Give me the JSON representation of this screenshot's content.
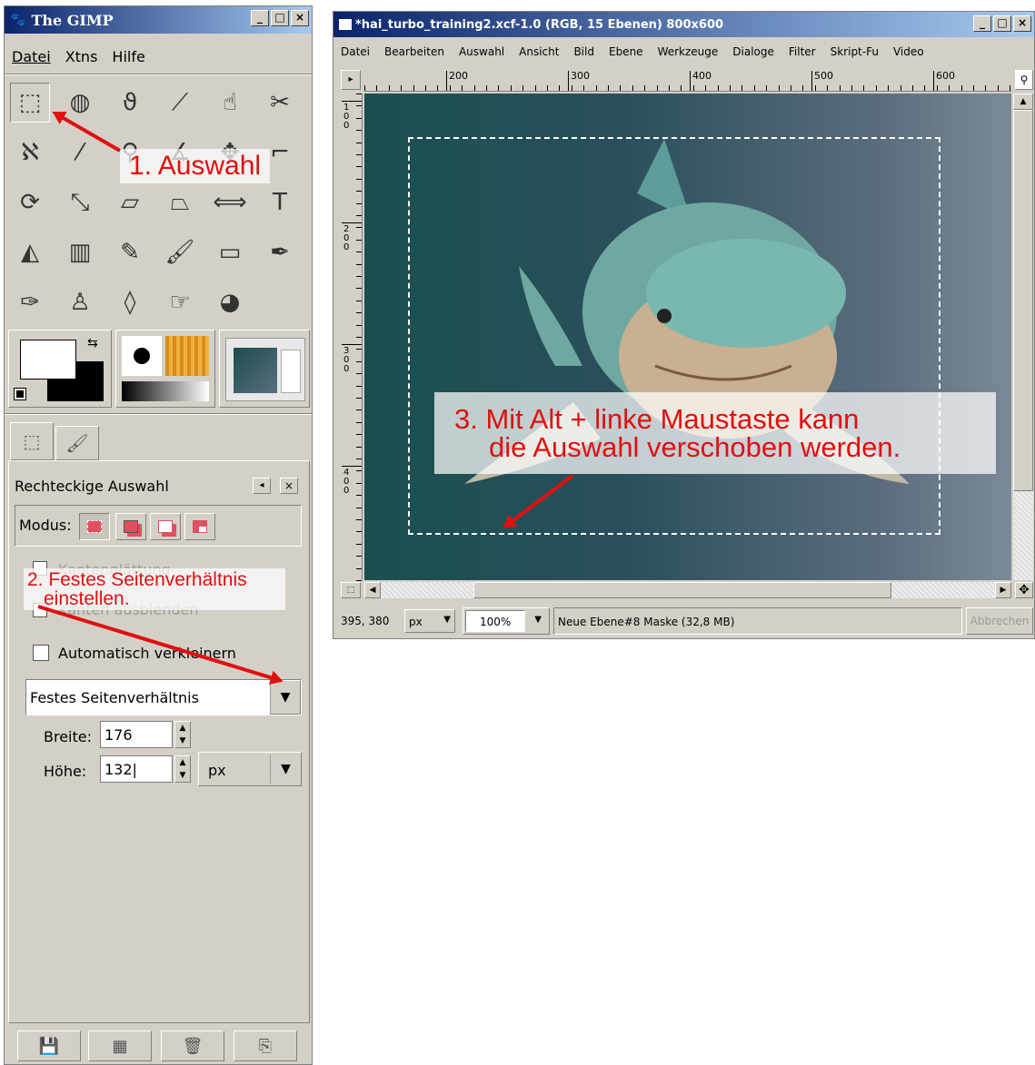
{
  "toolbox": {
    "title": "The GIMP",
    "menu": [
      "Datei",
      "Xtns",
      "Hilfe"
    ],
    "window_controls": [
      "_",
      "□",
      "×"
    ],
    "tools": [
      {
        "name": "rect-select",
        "glyph": "⬚"
      },
      {
        "name": "ellipse-select",
        "glyph": "◍"
      },
      {
        "name": "lasso",
        "glyph": "ϑ"
      },
      {
        "name": "magic-wand",
        "glyph": "⟋"
      },
      {
        "name": "select-by-color",
        "glyph": "☝"
      },
      {
        "name": "scissors",
        "glyph": "✂"
      },
      {
        "name": "paths",
        "glyph": "ℵ"
      },
      {
        "name": "color-picker",
        "glyph": "⁄"
      },
      {
        "name": "zoom",
        "glyph": "⚲"
      },
      {
        "name": "measure",
        "glyph": "∡"
      },
      {
        "name": "move",
        "glyph": "✥"
      },
      {
        "name": "crop",
        "glyph": "⌐"
      },
      {
        "name": "rotate",
        "glyph": "⟳"
      },
      {
        "name": "scale",
        "glyph": "⤡"
      },
      {
        "name": "shear",
        "glyph": "▱"
      },
      {
        "name": "perspective",
        "glyph": "⏢"
      },
      {
        "name": "flip",
        "glyph": "⟺"
      },
      {
        "name": "text",
        "glyph": "T"
      },
      {
        "name": "bucket-fill",
        "glyph": "◭"
      },
      {
        "name": "blend",
        "glyph": "▥"
      },
      {
        "name": "pencil",
        "glyph": "✎"
      },
      {
        "name": "paintbrush",
        "glyph": "🖌"
      },
      {
        "name": "eraser",
        "glyph": "▭"
      },
      {
        "name": "airbrush",
        "glyph": "✒"
      },
      {
        "name": "ink",
        "glyph": "✑"
      },
      {
        "name": "clone",
        "glyph": "♙"
      },
      {
        "name": "convolve",
        "glyph": "◊"
      },
      {
        "name": "smudge",
        "glyph": "☞"
      },
      {
        "name": "dodge-burn",
        "glyph": "◕"
      }
    ],
    "tool_options": {
      "title": "Rechteckige Auswahl",
      "mode_label": "Modus:",
      "antialias_label": "Kantenglättung",
      "feather_label": "Kanten ausblenden",
      "auto_shrink_label": "Automatisch verkleinern",
      "fixed_mode": "Festes Seitenverhältnis",
      "width_label": "Breite:",
      "width_value": "176",
      "height_label": "Höhe:",
      "height_value": "132",
      "unit": "px"
    },
    "footer_icons": [
      "save-icon",
      "restore-icon",
      "delete-icon",
      "reset-icon"
    ]
  },
  "image_window": {
    "title": "*hai_turbo_training2.xcf-1.0 (RGB, 15 Ebenen) 800x600",
    "menu": [
      "Datei",
      "Bearbeiten",
      "Auswahl",
      "Ansicht",
      "Bild",
      "Ebene",
      "Werkzeuge",
      "Dialoge",
      "Filter",
      "Skript-Fu",
      "Video"
    ],
    "ruler_top": [
      "200",
      "300",
      "400",
      "500",
      "600"
    ],
    "ruler_left": [
      "1\n0\n0",
      "2\n0\n0",
      "3\n0\n0",
      "4\n0\n0"
    ],
    "status": {
      "coords": "395, 380",
      "unit": "px",
      "zoom": "100%",
      "info": "Neue Ebene#8 Maske (32,8 MB)",
      "cancel": "Abbrechen"
    }
  },
  "annotations": {
    "a1": "1. Auswahl",
    "a2_line1": "2. Festes Seitenverhältnis",
    "a2_line2": "einstellen.",
    "a3_line1": "3. Mit Alt + linke Maustaste kann",
    "a3_line2": "die Auswahl verschoben werden."
  },
  "colors": {
    "accent": "#e01010",
    "title_start": "#0a246a",
    "title_end": "#a6caf0",
    "panel": "#d4d0c8"
  }
}
